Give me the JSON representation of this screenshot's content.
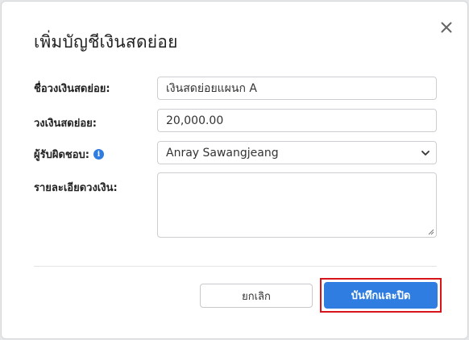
{
  "dialog": {
    "title": "เพิ่มบัญชีเงินสดย่อย",
    "close_icon": "close-icon"
  },
  "form": {
    "fund_name": {
      "label": "ชื่อวงเงินสดย่อย:",
      "value": "เงินสดย่อยแผนก A"
    },
    "amount": {
      "label": "วงเงินสดย่อย:",
      "value": "20,000.00"
    },
    "responsible": {
      "label": "ผู้รับผิดชอบ:",
      "value": "Anray Sawangjeang",
      "info_icon": "info-icon"
    },
    "details": {
      "label": "รายละเอียดวงเงิน:",
      "value": ""
    }
  },
  "footer": {
    "cancel_label": "ยกเลิก",
    "save_label": "บันทึกและปิด"
  },
  "colors": {
    "primary": "#2f7de1",
    "highlight": "#d7141a"
  }
}
